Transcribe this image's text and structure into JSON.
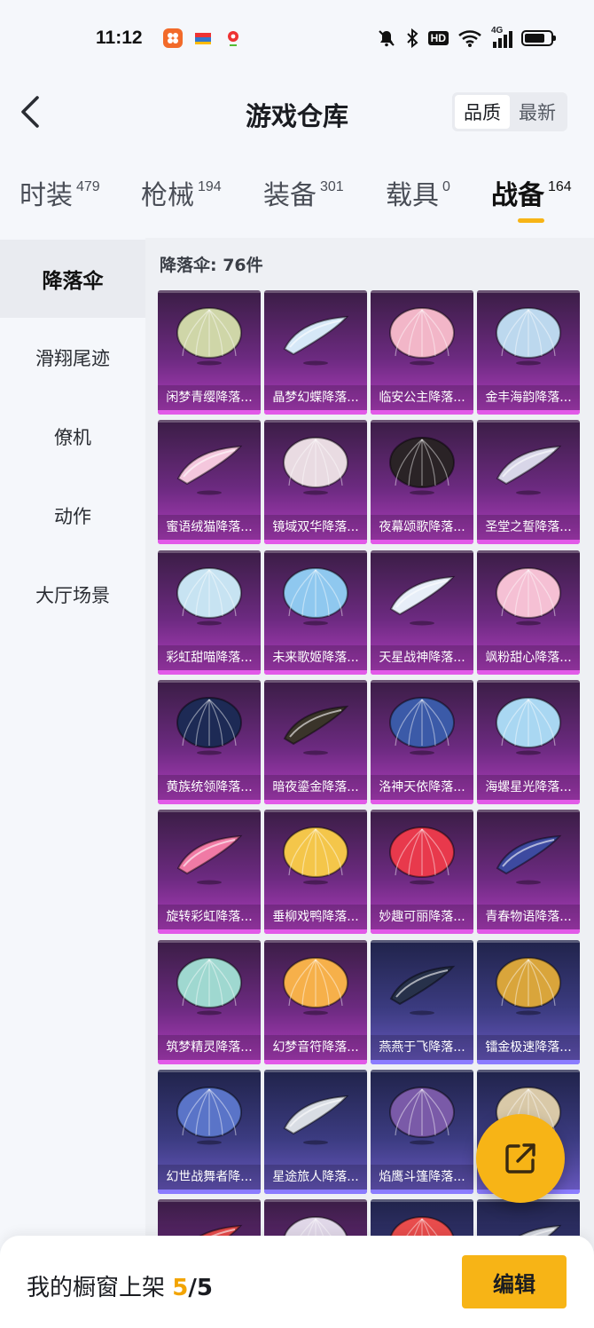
{
  "status_bar": {
    "time": "11:12",
    "network": "4G",
    "hd_badge": "HD",
    "battery_percent": 80,
    "app_icons": [
      "photo-app-icon",
      "wallet-app-icon",
      "location-app-icon"
    ],
    "status_icons": [
      "mute-icon",
      "bluetooth-icon",
      "hd-icon",
      "wifi-icon",
      "signal-icon",
      "battery-icon"
    ]
  },
  "header": {
    "title": "游戏仓库",
    "sort_options": [
      "品质",
      "最新"
    ],
    "sort_active": "品质"
  },
  "tabs": [
    {
      "label": "时装",
      "count": "479"
    },
    {
      "label": "枪械",
      "count": "194"
    },
    {
      "label": "装备",
      "count": "301"
    },
    {
      "label": "载具",
      "count": "0"
    },
    {
      "label": "战备",
      "count": "164",
      "active": true
    }
  ],
  "sidebar": {
    "items": [
      {
        "label": "降落伞",
        "active": true
      },
      {
        "label": "滑翔尾迹"
      },
      {
        "label": "僚机"
      },
      {
        "label": "动作"
      },
      {
        "label": "大厅场景"
      }
    ]
  },
  "grid": {
    "header": "降落伞: 76件",
    "items": [
      {
        "name": "闲梦青缨降落...",
        "rarity": "purple",
        "color": "#cfd6a8"
      },
      {
        "name": "晶梦幻蝶降落...",
        "rarity": "purple",
        "color": "#d6e8f7"
      },
      {
        "name": "临安公主降落...",
        "rarity": "purple",
        "color": "#f2b6c8"
      },
      {
        "name": "金丰海韵降落...",
        "rarity": "purple",
        "color": "#bcd8ee"
      },
      {
        "name": "蜜语绒猫降落...",
        "rarity": "purple",
        "color": "#f4c7dd"
      },
      {
        "name": "镜域双华降落...",
        "rarity": "purple",
        "color": "#e9dbe2"
      },
      {
        "name": "夜幕颂歌降落...",
        "rarity": "purple",
        "color": "#2a2326"
      },
      {
        "name": "圣堂之誓降落...",
        "rarity": "purple",
        "color": "#d8d6e8"
      },
      {
        "name": "彩虹甜喵降落...",
        "rarity": "purple",
        "color": "#c7e3f2"
      },
      {
        "name": "未来歌姬降落...",
        "rarity": "purple",
        "color": "#8fc8ef"
      },
      {
        "name": "天星战神降落...",
        "rarity": "purple",
        "color": "#e7eef8"
      },
      {
        "name": "飒粉甜心降落...",
        "rarity": "purple",
        "color": "#f5c0d4"
      },
      {
        "name": "黄族统领降落...",
        "rarity": "purple",
        "color": "#1d2a55"
      },
      {
        "name": "暗夜鎏金降落...",
        "rarity": "purple",
        "color": "#3a342a"
      },
      {
        "name": "洛神天依降落...",
        "rarity": "purple",
        "color": "#3b5aa8"
      },
      {
        "name": "海螺星光降落...",
        "rarity": "purple",
        "color": "#a9d7f2"
      },
      {
        "name": "旋转彩虹降落...",
        "rarity": "purple",
        "color": "#f07aa5"
      },
      {
        "name": "垂柳戏鸭降落...",
        "rarity": "purple",
        "color": "#f4c64a"
      },
      {
        "name": "妙趣可丽降落...",
        "rarity": "purple",
        "color": "#e8394c"
      },
      {
        "name": "青春物语降落...",
        "rarity": "purple",
        "color": "#3d4aa0"
      },
      {
        "name": "筑梦精灵降落...",
        "rarity": "purple",
        "color": "#9fd8d0"
      },
      {
        "name": "幻梦音符降落...",
        "rarity": "purple",
        "color": "#f6b04a"
      },
      {
        "name": "燕燕于飞降落...",
        "rarity": "blue",
        "color": "#27314a"
      },
      {
        "name": "镭金极速降落...",
        "rarity": "blue",
        "color": "#d9a53b"
      },
      {
        "name": "幻世战舞者降...",
        "rarity": "blue",
        "color": "#5a74c8"
      },
      {
        "name": "星途旅人降落...",
        "rarity": "blue",
        "color": "#d9dde4"
      },
      {
        "name": "焰鹰斗篷降落...",
        "rarity": "blue",
        "color": "#7a5aa8"
      },
      {
        "name": "",
        "rarity": "blue",
        "color": "#d9c9a8"
      },
      {
        "name": "",
        "rarity": "purple",
        "color": "#e54a4a"
      },
      {
        "name": "",
        "rarity": "purple",
        "color": "#e0d7e8"
      },
      {
        "name": "",
        "rarity": "blue",
        "color": "#e84c4c"
      },
      {
        "name": "",
        "rarity": "blue",
        "color": "#d0d3dc"
      }
    ]
  },
  "fab": {
    "icon": "share-icon"
  },
  "bottom_bar": {
    "label": "我的橱窗上架 ",
    "count": "5",
    "separator": "/",
    "total": "5",
    "edit_label": "编辑"
  },
  "colors": {
    "accent": "#f7b416",
    "purple_card": "#7a2b8e",
    "blue_card": "#3b3b80"
  }
}
